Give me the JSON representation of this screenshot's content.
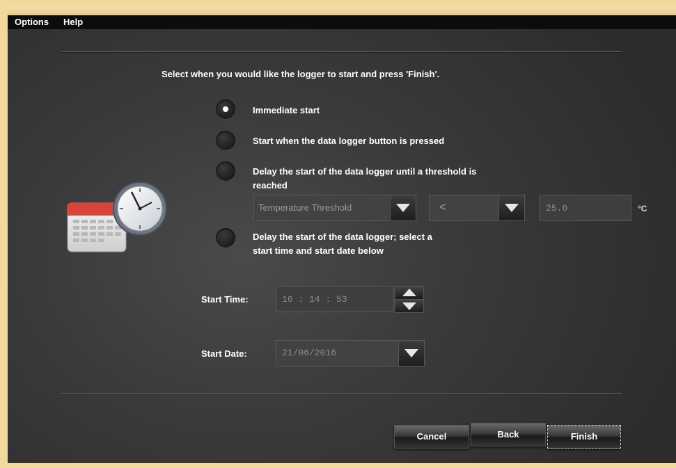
{
  "menu": {
    "items": [
      "Options",
      "Help"
    ]
  },
  "instructions": "Select when you would like the logger to start and press 'Finish'.",
  "start_options": [
    {
      "label_lines": [
        "Immediate start"
      ],
      "selected": true
    },
    {
      "label_lines": [
        "Start when the data logger button is pressed"
      ],
      "selected": false
    },
    {
      "label_lines": [
        "Delay the start of the data logger until a threshold is",
        "reached"
      ],
      "selected": false
    },
    {
      "label_lines": [
        "Delay the start of the data logger; select a",
        "start time and start date below"
      ],
      "selected": false
    }
  ],
  "threshold": {
    "type_value": "Temperature Threshold",
    "operator_value": "<",
    "value": "25.0",
    "unit": "°C"
  },
  "start_time": {
    "label": "Start Time:",
    "value": "16 : 14 : 53"
  },
  "start_date": {
    "label": "Start Date:",
    "value": "21/06/2016"
  },
  "buttons": {
    "cancel": "Cancel",
    "back": "Back",
    "finish": "Finish"
  },
  "icons": {
    "calendar_clock": "calendar-clock-icon",
    "accent_red": "#d9443a"
  }
}
